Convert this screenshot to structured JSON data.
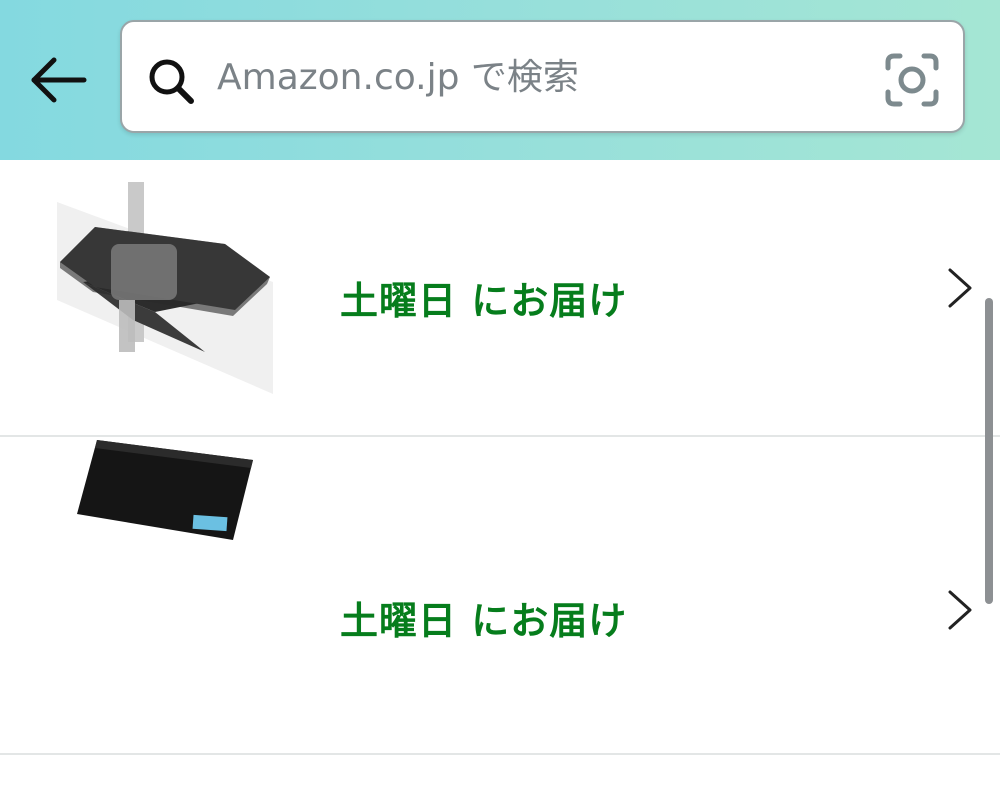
{
  "search": {
    "placeholder": "Amazon.co.jp で検索",
    "value": ""
  },
  "header": {
    "back_icon": "back-arrow-icon",
    "search_icon": "search-icon",
    "camera_icon": "camera-lens-icon"
  },
  "results": [
    {
      "thumbnail": "monitor-arm-shelf-tray",
      "delivery_text": "土曜日 にお届け",
      "chevron_icon": "chevron-right-icon"
    },
    {
      "thumbnail": "black-rubber-mat",
      "delivery_text": "土曜日 にお届け",
      "chevron_icon": "chevron-right-icon"
    }
  ],
  "colors": {
    "header_gradient_start": "#84d9e0",
    "header_gradient_end": "#a5e6d4",
    "delivery_green": "#067d1c",
    "divider": "#e3e6e6"
  }
}
